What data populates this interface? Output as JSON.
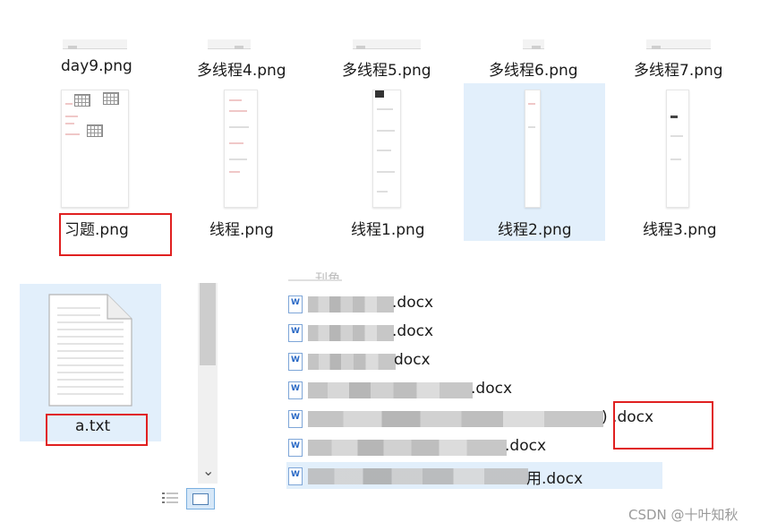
{
  "top_row": [
    "day9.png",
    "多线程4.png",
    "多线程5.png",
    "多线程6.png",
    "多线程7.png"
  ],
  "second_row": [
    "习题.png",
    "线程.png",
    "线程1.png",
    "线程2.png",
    "线程3.png"
  ],
  "txt_file": "a.txt",
  "doc_list": {
    "partial_header": "刊角",
    "items": [
      ".docx",
      ".docx",
      "docx",
      ".docx",
      ") .docx",
      ".docx",
      "用.docx"
    ]
  },
  "scrollbar": {
    "down_arrow": "⌄"
  },
  "watermark": "CSDN @十叶知秋",
  "colors": {
    "highlight_box": "#e02020",
    "selection": "#e2effb"
  }
}
